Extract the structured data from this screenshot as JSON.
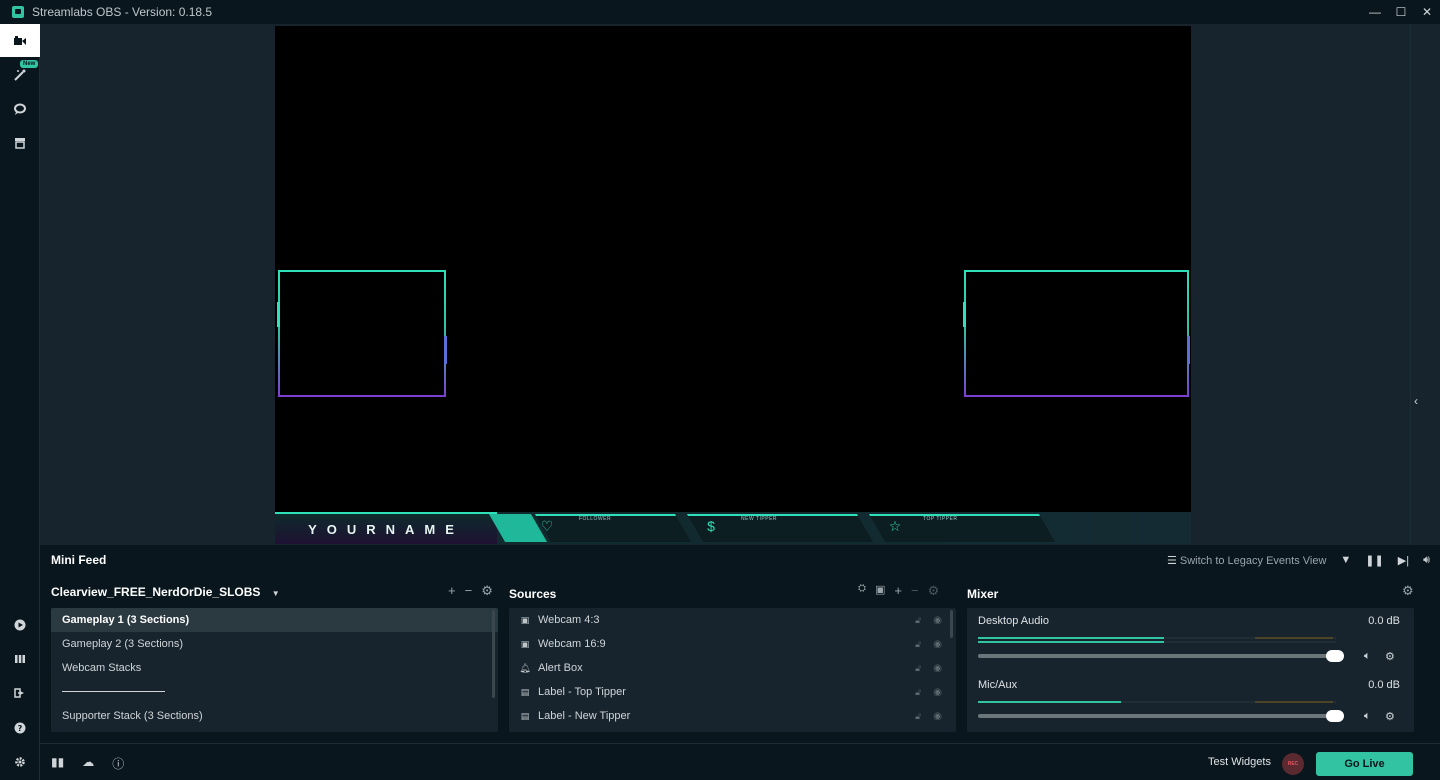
{
  "window": {
    "title": "Streamlabs OBS - Version: 0.18.5",
    "minimize": "—",
    "maximize": "☐",
    "close": "✕"
  },
  "nav": {
    "new_badge": "New"
  },
  "overlay": {
    "name_text": "YOURNAME",
    "follower_label": "FOLLOWER",
    "new_tipper_label": "NEW TIPPER",
    "top_tipper_label": "TOP TIPPER",
    "dollar_glyph": "$"
  },
  "minifeed": {
    "title": "Mini Feed",
    "legacy_label": "Switch to Legacy Events View"
  },
  "scenes": {
    "collection_name": "Clearview_FREE_NerdOrDie_SLOBS",
    "items": [
      "Gameplay 1 (3 Sections)",
      "Gameplay 2 (3 Sections)",
      "Webcam Stacks",
      "Supporter Stack (3 Sections)"
    ]
  },
  "sources": {
    "title": "Sources",
    "items": [
      {
        "label": "Webcam 4:3",
        "icon": "image-icon"
      },
      {
        "label": "Webcam 16:9",
        "icon": "image-icon"
      },
      {
        "label": "Alert Box",
        "icon": "bell-icon"
      },
      {
        "label": "Label - Top Tipper",
        "icon": "file-icon"
      },
      {
        "label": "Label - New Tipper",
        "icon": "file-icon"
      }
    ]
  },
  "mixer": {
    "title": "Mixer",
    "channels": [
      {
        "name": "Desktop Audio",
        "db": "0.0 dB",
        "level": 0.52
      },
      {
        "name": "Mic/Aux",
        "db": "0.0 dB",
        "level": 0.4
      }
    ]
  },
  "footer": {
    "test_widgets": "Test Widgets",
    "rec": "REC",
    "go_live": "Go Live"
  },
  "colors": {
    "accent": "#31c3a2",
    "background": "#09161d",
    "panel": "#17242d"
  }
}
